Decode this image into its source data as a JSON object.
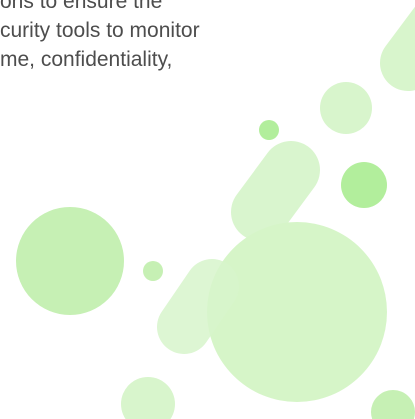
{
  "content": {
    "paragraph_lines": [
      "ons to ensure the",
      "curity tools to monitor",
      "me, confidentiality,"
    ]
  },
  "colors": {
    "text": "#4d4d4d",
    "light_green": "#d8f5cc",
    "mid_green": "#c6f0b4",
    "bright_green": "#b2ee9c",
    "background": "#ffffff"
  }
}
